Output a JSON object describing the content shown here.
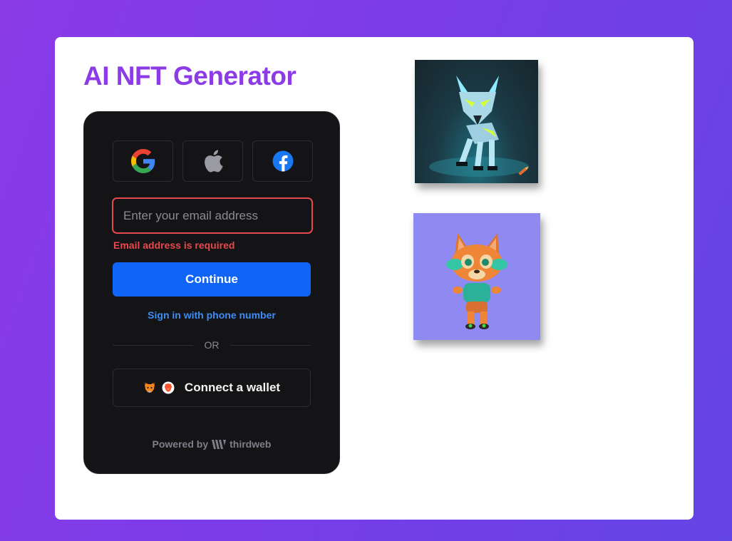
{
  "page": {
    "title": "AI NFT Generator"
  },
  "login": {
    "social_buttons": [
      {
        "name": "google-icon"
      },
      {
        "name": "apple-icon"
      },
      {
        "name": "facebook-icon"
      }
    ],
    "email": {
      "placeholder": "Enter your email address",
      "value": "",
      "error": "Email address is required"
    },
    "continue_label": "Continue",
    "phone_link": "Sign in with phone number",
    "divider_label": "OR",
    "wallet_label": "Connect a wallet",
    "wallet_icons": [
      "metamask-icon",
      "brave-icon"
    ],
    "powered_by_label": "Powered by",
    "powered_by_brand": "thirdweb"
  },
  "gallery": [
    {
      "name": "nft-image-robot-wolf"
    },
    {
      "name": "nft-image-cartoon-fox"
    }
  ],
  "colors": {
    "accent": "#8c3be6",
    "primary_button": "#1065f7",
    "error": "#e5484d",
    "link": "#3f8cf5",
    "panel": "#141417"
  }
}
